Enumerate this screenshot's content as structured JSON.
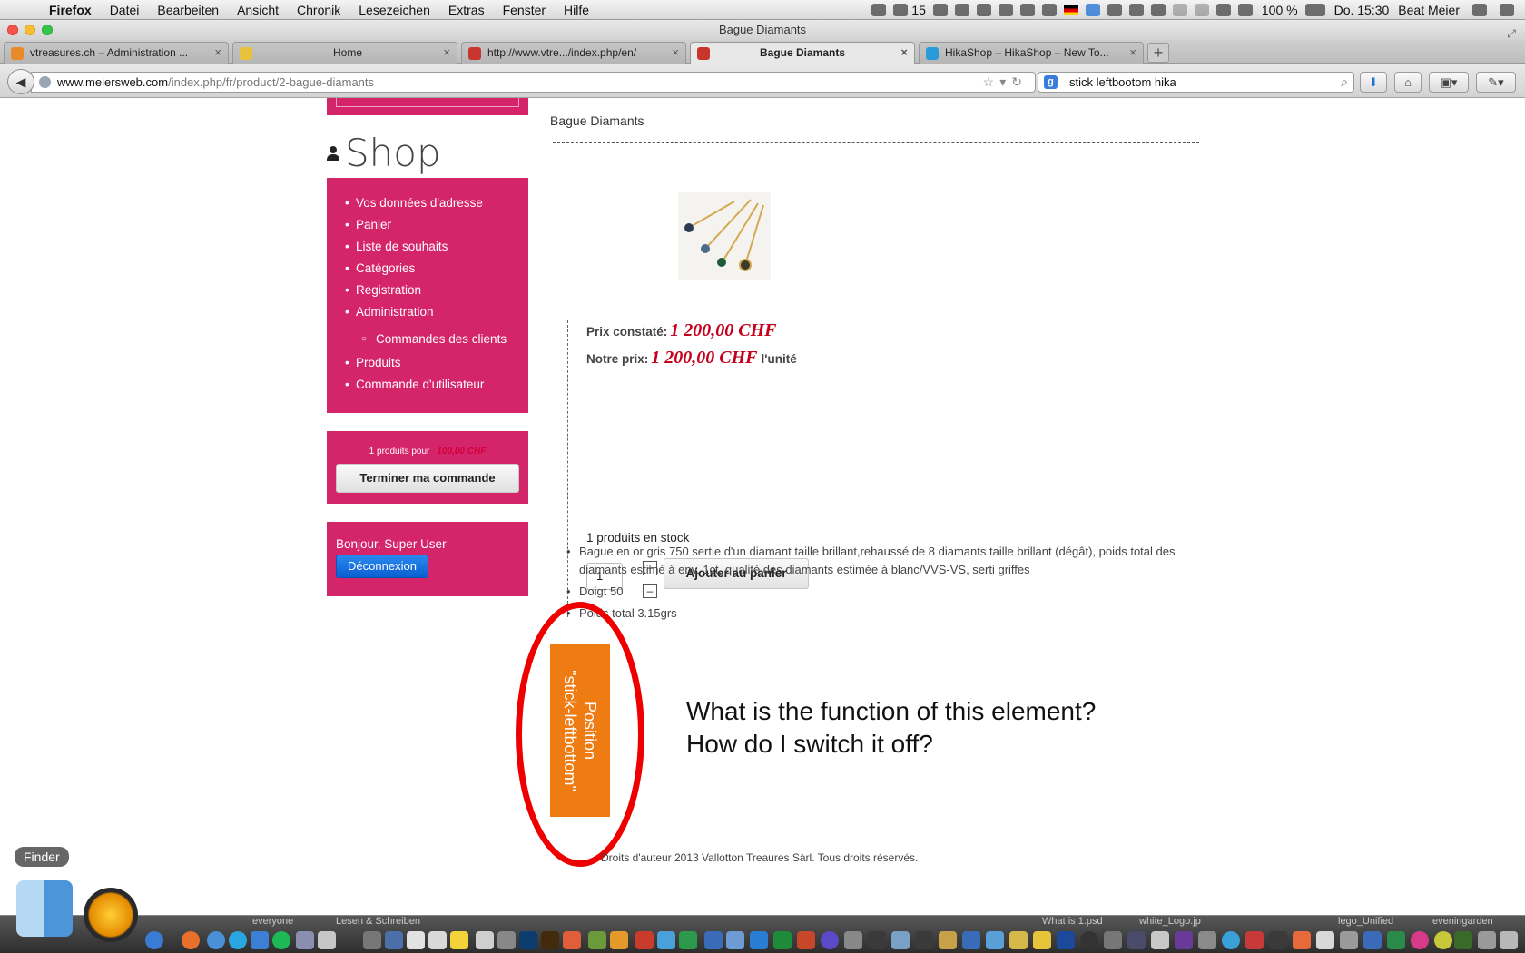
{
  "menubar": {
    "app": "Firefox",
    "items": [
      "Datei",
      "Bearbeiten",
      "Ansicht",
      "Chronik",
      "Lesezeichen",
      "Extras",
      "Fenster",
      "Hilfe"
    ],
    "status": {
      "count": "15",
      "battery": "100 %",
      "clock": "Do. 15:30",
      "user": "Beat Meier"
    }
  },
  "window": {
    "title": "Bague Diamants"
  },
  "tabs": [
    {
      "label": "vtreasures.ch – Administration ...",
      "icon": "joomla-icon",
      "color": "#e88a2a"
    },
    {
      "label": "Home",
      "icon": "key-icon",
      "color": "#e8c23a"
    },
    {
      "label": "http://www.vtre.../index.php/en/",
      "icon": "joomla-icon",
      "color": "#c7352c"
    },
    {
      "label": "Bague Diamants",
      "icon": "joomla-icon",
      "color": "#c7352c"
    },
    {
      "label": "HikaShop – HikaShop – New To...",
      "icon": "hikashop-icon",
      "color": "#2a9ad8"
    }
  ],
  "nav": {
    "url_domain": "www.meiersweb.com",
    "url_path": "/index.php/fr/product/2-bague-diamants",
    "search_value": "stick leftbootom hika"
  },
  "page": {
    "shop_title": "Shop",
    "menu": [
      "Vos données d'adresse",
      "Panier",
      "Liste de souhaits",
      "Catégories",
      "Registration",
      "Administration",
      "Commandes des clients",
      "Produits",
      "Commande d'utilisateur"
    ],
    "cart": {
      "count_text": "1 produits pour",
      "amount": "100,00 CHF",
      "checkout": "Terminer ma commande"
    },
    "login": {
      "greeting": "Bonjour, Super User",
      "logout": "Déconnexion"
    },
    "breadcrumb": "Bague Diamants",
    "price": {
      "listed_label": "Prix constaté:",
      "listed_value": "1 200,00 CHF",
      "our_label": "Notre prix:",
      "our_value": "1 200,00 CHF",
      "unit": "l'unité"
    },
    "stock": "1 produits en stock",
    "quantity": "1",
    "plus": "+",
    "minus": "–",
    "add_to_cart": "Ajouter au panier",
    "description": [
      "Bague en or gris 750 sertie d'un diamant taille brillant,rehaussé de 8 diamants taille brillant (dégât), poids total des diamants estimé à env. 1ct, qualité des diamants estimée à blanc/VVS-VS, serti griffes",
      "Doigt 50",
      "Poids total 3.15grs"
    ],
    "position_box": {
      "line1": "Position",
      "line2": "\"stick-leftbottom\"",
      "color": "#ee7c12"
    },
    "annotation": {
      "line1": "What is the function of this element?",
      "line2": "How do I switch it off?",
      "color": "#ee0000"
    },
    "footer": "Droits d'auteur 2013 Vallotton Treaures Sàrl. Tous droits réservés."
  },
  "dock": {
    "tooltip": "Finder",
    "labels": [
      "everyone",
      "Lesen & Schreiben",
      "What is 1.psd",
      "white_Logo.jp",
      "lego_Unified",
      "eveningarden"
    ]
  },
  "colors": {
    "pink": "#d4246a",
    "price": "#c4001c",
    "logout": "#0a5fd0"
  }
}
